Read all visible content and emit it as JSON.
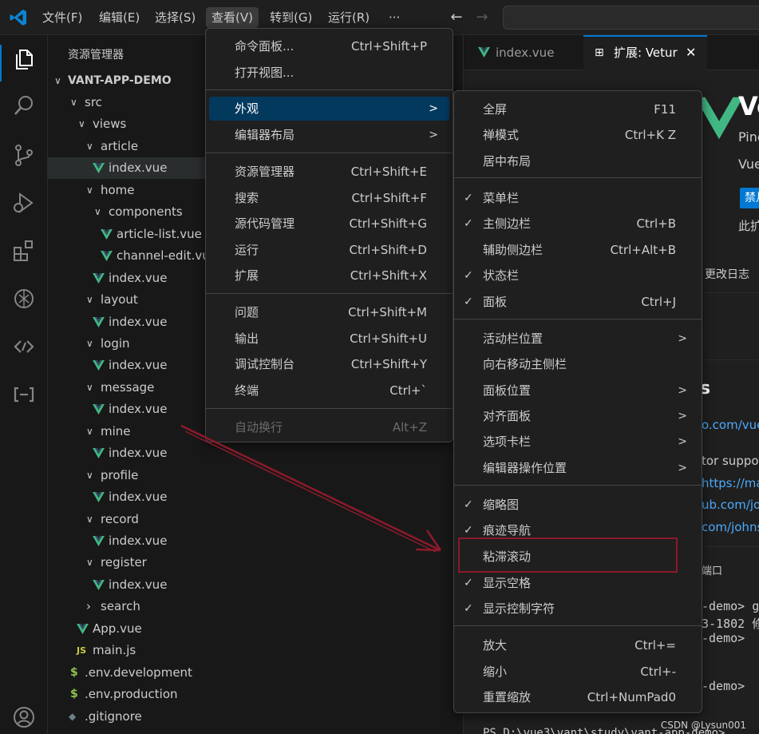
{
  "menubar": {
    "items": [
      "文件(F)",
      "编辑(E)",
      "选择(S)",
      "查看(V)",
      "转到(G)",
      "运行(R)",
      "···"
    ]
  },
  "sidebar": {
    "title": "资源管理器",
    "root": "VANT-APP-DEMO",
    "tree": [
      {
        "label": "src",
        "type": "folder"
      },
      {
        "label": "views",
        "type": "folder"
      },
      {
        "label": "article",
        "type": "folder"
      },
      {
        "label": "index.vue",
        "type": "vue"
      },
      {
        "label": "home",
        "type": "folder"
      },
      {
        "label": "components",
        "type": "folder"
      },
      {
        "label": "article-list.vue",
        "type": "vue"
      },
      {
        "label": "channel-edit.vue",
        "type": "vue"
      },
      {
        "label": "index.vue",
        "type": "vue"
      },
      {
        "label": "layout",
        "type": "folder"
      },
      {
        "label": "index.vue",
        "type": "vue"
      },
      {
        "label": "login",
        "type": "folder"
      },
      {
        "label": "index.vue",
        "type": "vue"
      },
      {
        "label": "message",
        "type": "folder"
      },
      {
        "label": "index.vue",
        "type": "vue"
      },
      {
        "label": "mine",
        "type": "folder"
      },
      {
        "label": "index.vue",
        "type": "vue"
      },
      {
        "label": "profile",
        "type": "folder"
      },
      {
        "label": "index.vue",
        "type": "vue"
      },
      {
        "label": "record",
        "type": "folder"
      },
      {
        "label": "index.vue",
        "type": "vue"
      },
      {
        "label": "register",
        "type": "folder"
      },
      {
        "label": "index.vue",
        "type": "vue"
      },
      {
        "label": "search",
        "type": "folder"
      },
      {
        "label": "App.vue",
        "type": "vue"
      },
      {
        "label": "main.js",
        "type": "js"
      },
      {
        "label": ".env.development",
        "type": "env"
      },
      {
        "label": ".env.production",
        "type": "env"
      },
      {
        "label": ".gitignore",
        "type": "git"
      }
    ]
  },
  "editor": {
    "tabs": [
      "index.vue",
      "扩展: Vetur"
    ],
    "fragments": [
      "Ve",
      "Pine",
      "Vue",
      "禁月",
      "此扩",
      "更改日志",
      "s",
      "o.com/vuej",
      "tor suppo",
      "https://ma",
      "ub.com/jo",
      "com/johns",
      "端口",
      "-demo> gi",
      "3-1802 修",
      "-demo>",
      "-demo>",
      "PS D:\\vue3\\vant\\study\\vant-app-demo>"
    ]
  },
  "view_menu": {
    "items": [
      {
        "label": "命令面板...",
        "shortcut": "Ctrl+Shift+P"
      },
      {
        "label": "打开视图...",
        "shortcut": ""
      },
      {
        "label": "外观",
        "shortcut": "",
        "submenu": true
      },
      {
        "label": "编辑器布局",
        "shortcut": "",
        "submenu": true
      },
      {
        "label": "资源管理器",
        "shortcut": "Ctrl+Shift+E"
      },
      {
        "label": "搜索",
        "shortcut": "Ctrl+Shift+F"
      },
      {
        "label": "源代码管理",
        "shortcut": "Ctrl+Shift+G"
      },
      {
        "label": "运行",
        "shortcut": "Ctrl+Shift+D"
      },
      {
        "label": "扩展",
        "shortcut": "Ctrl+Shift+X"
      },
      {
        "label": "问题",
        "shortcut": "Ctrl+Shift+M"
      },
      {
        "label": "输出",
        "shortcut": "Ctrl+Shift+U"
      },
      {
        "label": "调试控制台",
        "shortcut": "Ctrl+Shift+Y"
      },
      {
        "label": "终端",
        "shortcut": "Ctrl+`"
      },
      {
        "label": "自动换行",
        "shortcut": "Alt+Z",
        "disabled": true
      }
    ]
  },
  "appearance_menu": {
    "items": [
      {
        "label": "全屏",
        "shortcut": "F11",
        "checked": false
      },
      {
        "label": "禅模式",
        "shortcut": "Ctrl+K Z",
        "checked": false
      },
      {
        "label": "居中布局",
        "shortcut": "",
        "checked": false
      },
      {
        "label": "菜单栏",
        "shortcut": "",
        "checked": true
      },
      {
        "label": "主侧边栏",
        "shortcut": "Ctrl+B",
        "checked": true
      },
      {
        "label": "辅助侧边栏",
        "shortcut": "Ctrl+Alt+B",
        "checked": false
      },
      {
        "label": "状态栏",
        "shortcut": "",
        "checked": true
      },
      {
        "label": "面板",
        "shortcut": "Ctrl+J",
        "checked": true
      },
      {
        "label": "活动栏位置",
        "shortcut": "",
        "submenu": true
      },
      {
        "label": "向右移动主侧栏",
        "shortcut": ""
      },
      {
        "label": "面板位置",
        "shortcut": "",
        "submenu": true
      },
      {
        "label": "对齐面板",
        "shortcut": "",
        "submenu": true
      },
      {
        "label": "选项卡栏",
        "shortcut": "",
        "submenu": true
      },
      {
        "label": "编辑器操作位置",
        "shortcut": "",
        "submenu": true
      },
      {
        "label": "缩略图",
        "shortcut": "",
        "checked": true
      },
      {
        "label": "痕迹导航",
        "shortcut": "",
        "checked": true
      },
      {
        "label": "粘滞滚动",
        "shortcut": "",
        "checked": false
      },
      {
        "label": "显示空格",
        "shortcut": "",
        "checked": true
      },
      {
        "label": "显示控制字符",
        "shortcut": "",
        "checked": true
      },
      {
        "label": "放大",
        "shortcut": "Ctrl+="
      },
      {
        "label": "缩小",
        "shortcut": "Ctrl+-"
      },
      {
        "label": "重置缩放",
        "shortcut": "Ctrl+NumPad0"
      }
    ]
  },
  "watermark": "CSDN @Lysun001",
  "colors": {
    "accent": "#0078d4",
    "vue_green": "#41b883",
    "annotation_red": "#8b1a2b"
  }
}
